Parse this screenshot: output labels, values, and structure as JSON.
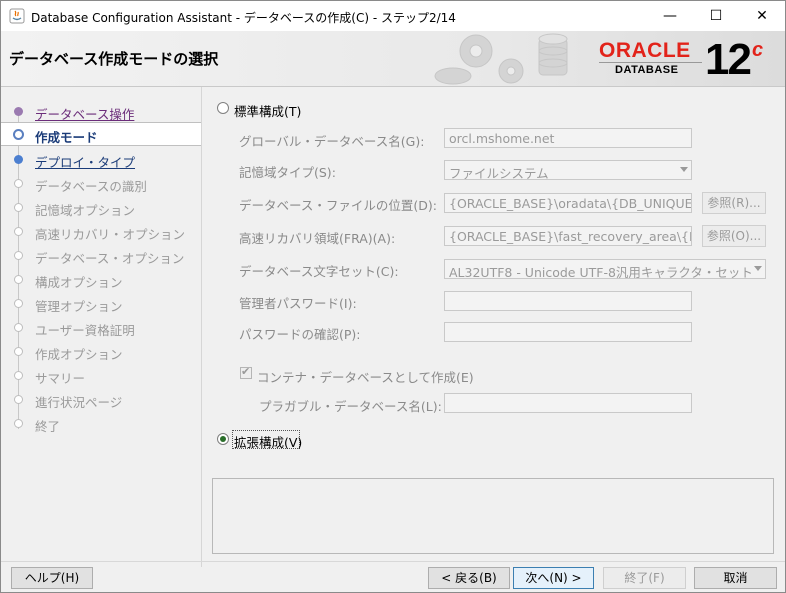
{
  "window": {
    "title": "Database Configuration Assistant - データベースの作成(C) - ステップ2/14",
    "minimize_glyph": "—",
    "maximize_glyph": "☐",
    "close_glyph": "✕"
  },
  "header": {
    "page_title": "データベース作成モードの選択",
    "brand": "ORACLE",
    "brand_sub": "DATABASE",
    "version": "12",
    "version_sup": "c"
  },
  "steps": [
    {
      "label": "データベース操作",
      "state": "done"
    },
    {
      "label": "作成モード",
      "state": "current"
    },
    {
      "label": "デプロイ・タイプ",
      "state": "next"
    },
    {
      "label": "データベースの識別",
      "state": "off"
    },
    {
      "label": "記憶域オプション",
      "state": "off"
    },
    {
      "label": "高速リカバリ・オプション",
      "state": "off"
    },
    {
      "label": "データベース・オプション",
      "state": "off"
    },
    {
      "label": "構成オプション",
      "state": "off"
    },
    {
      "label": "管理オプション",
      "state": "off"
    },
    {
      "label": "ユーザー資格証明",
      "state": "off"
    },
    {
      "label": "作成オプション",
      "state": "off"
    },
    {
      "label": "サマリー",
      "state": "off"
    },
    {
      "label": "進行状況ページ",
      "state": "off"
    },
    {
      "label": "終了",
      "state": "off"
    }
  ],
  "typical": {
    "label": "標準構成(T)",
    "selected": false,
    "global_db_name_label": "グローバル・データベース名(G):",
    "global_db_name_value": "orcl.mshome.net",
    "storage_type_label": "記憶域タイプ(S):",
    "storage_type_value": "ファイルシステム",
    "db_file_location_label": "データベース・ファイルの位置(D):",
    "db_file_location_value": "{ORACLE_BASE}\\oradata\\{DB_UNIQUE_NAME}",
    "browse_label_1": "参照(R)...",
    "fra_label": "高速リカバリ領域(FRA)(A):",
    "fra_value": "{ORACLE_BASE}\\fast_recovery_area\\{DB_UNIQUE_NAME}",
    "browse_label_2": "参照(O)...",
    "charset_label": "データベース文字セット(C):",
    "charset_value": "AL32UTF8 - Unicode UTF-8汎用キャラクタ・セット",
    "admin_password_label": "管理者パスワード(I):",
    "admin_password_value": "",
    "confirm_password_label": "パスワードの確認(P):",
    "confirm_password_value": "",
    "container_db_label": "コンテナ・データベースとして作成(E)",
    "container_db_checked": true,
    "pdb_name_label": "プラガブル・データベース名(L):",
    "pdb_name_value": ""
  },
  "advanced": {
    "label": "拡張構成(V)",
    "selected": true
  },
  "footer": {
    "help": "ヘルプ(H)",
    "back": "< 戻る(B)",
    "next": "次へ(N) >",
    "finish": "終了(F)",
    "cancel": "取消"
  }
}
